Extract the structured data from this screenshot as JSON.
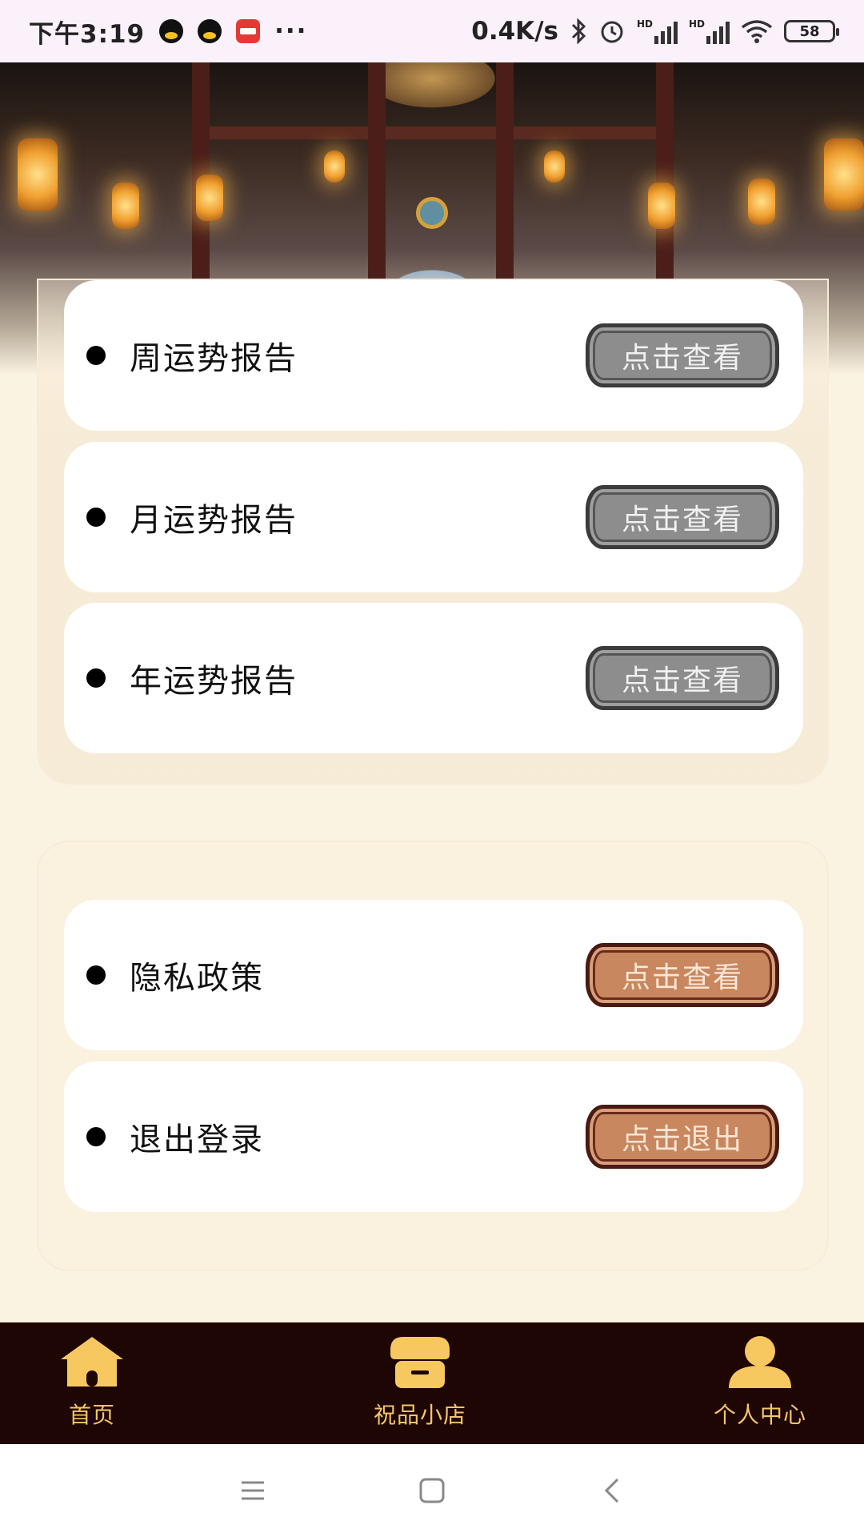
{
  "status_bar": {
    "time": "下午3:19",
    "more": "···",
    "net_speed": "0.4K/s",
    "battery": "58",
    "hd_label": "HD",
    "icons": [
      "qq-icon",
      "qq-icon",
      "app-icon",
      "bluetooth-icon",
      "alarm-icon",
      "signal-icon",
      "wifi-icon",
      "battery-icon"
    ]
  },
  "reports": [
    {
      "label": "周运势报告",
      "button": "点击查看"
    },
    {
      "label": "月运势报告",
      "button": "点击查看"
    },
    {
      "label": "年运势报告",
      "button": "点击查看"
    }
  ],
  "settings": [
    {
      "label": "隐私政策",
      "button": "点击查看"
    },
    {
      "label": "退出登录",
      "button": "点击退出"
    }
  ],
  "bottom_nav": {
    "items": [
      {
        "label": "首页",
        "icon": "home-icon"
      },
      {
        "label": "祝品小店",
        "icon": "shop-icon"
      },
      {
        "label": "个人中心",
        "icon": "user-icon"
      }
    ]
  },
  "colors": {
    "page_bg": "#fbf3e2",
    "nav_bg": "#1e0605",
    "nav_text": "#f5c569",
    "gray_button": "#8d8d8d",
    "brown_button": "#c8875f"
  }
}
